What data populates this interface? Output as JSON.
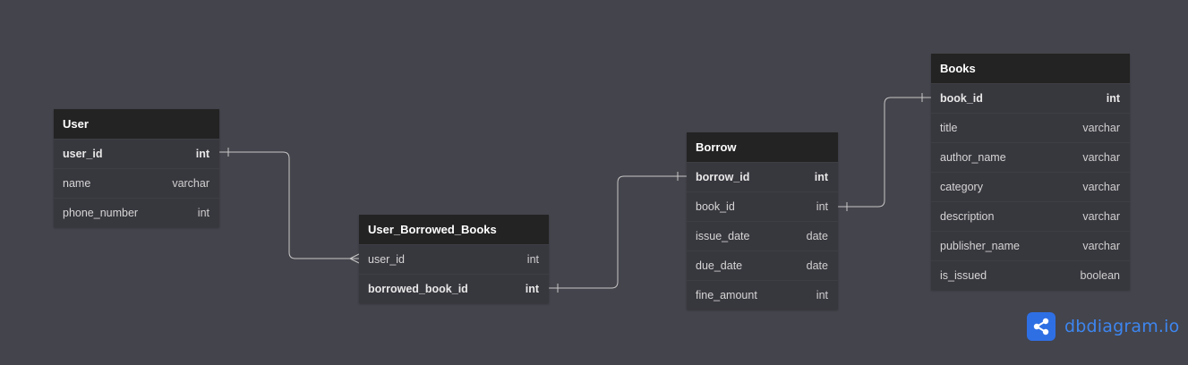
{
  "tables": {
    "user": {
      "name": "User",
      "columns": [
        {
          "name": "user_id",
          "type": "int"
        },
        {
          "name": "name",
          "type": "varchar"
        },
        {
          "name": "phone_number",
          "type": "int"
        }
      ]
    },
    "user_borrowed_books": {
      "name": "User_Borrowed_Books",
      "columns": [
        {
          "name": "user_id",
          "type": "int"
        },
        {
          "name": "borrowed_book_id",
          "type": "int"
        }
      ]
    },
    "borrow": {
      "name": "Borrow",
      "columns": [
        {
          "name": "borrow_id",
          "type": "int"
        },
        {
          "name": "book_id",
          "type": "int"
        },
        {
          "name": "issue_date",
          "type": "date"
        },
        {
          "name": "due_date",
          "type": "date"
        },
        {
          "name": "fine_amount",
          "type": "int"
        }
      ]
    },
    "books": {
      "name": "Books",
      "columns": [
        {
          "name": "book_id",
          "type": "int"
        },
        {
          "name": "title",
          "type": "varchar"
        },
        {
          "name": "author_name",
          "type": "varchar"
        },
        {
          "name": "category",
          "type": "varchar"
        },
        {
          "name": "description",
          "type": "varchar"
        },
        {
          "name": "publisher_name",
          "type": "varchar"
        },
        {
          "name": "is_issued",
          "type": "boolean"
        }
      ]
    }
  },
  "relationships": [
    {
      "from": "User.user_id",
      "to": "User_Borrowed_Books.user_id",
      "cardinality": "one-to-many"
    },
    {
      "from": "User_Borrowed_Books.borrowed_book_id",
      "to": "Borrow.borrow_id",
      "cardinality": "one-to-one"
    },
    {
      "from": "Borrow.book_id",
      "to": "Books.book_id",
      "cardinality": "one-to-one"
    }
  ],
  "brand": {
    "text": "dbdiagram.io",
    "icon": "share-nodes-icon"
  },
  "colors": {
    "background": "#44444c",
    "header": "#232323",
    "body": "#37373e",
    "link": "#c8c8c8",
    "brand": "#2f6fe4"
  }
}
